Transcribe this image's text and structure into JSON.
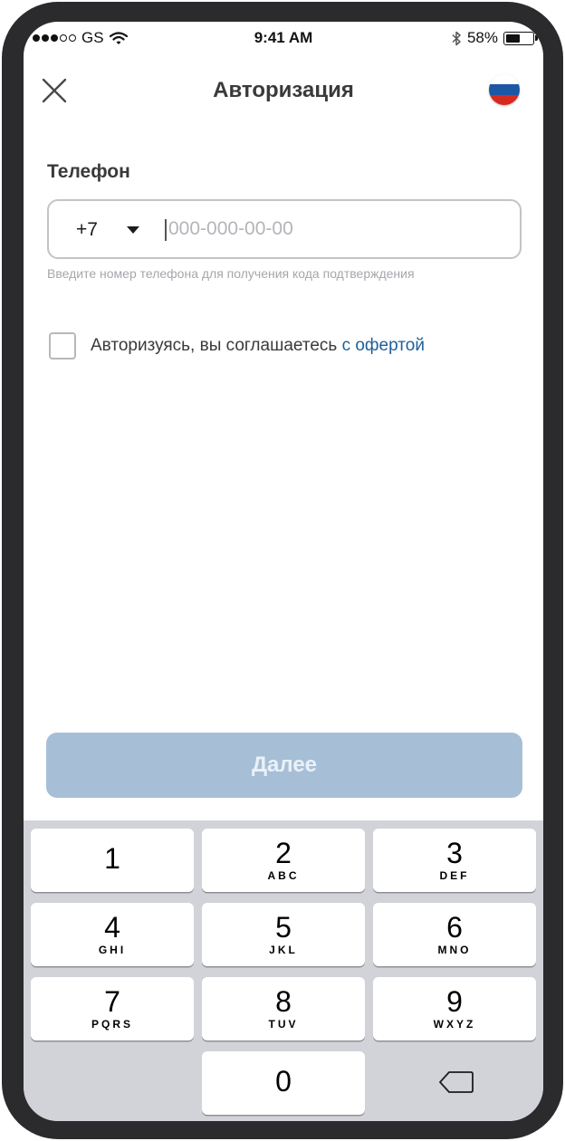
{
  "status_bar": {
    "carrier": "GS",
    "time": "9:41 AM",
    "battery_percent": "58%",
    "battery_level": 0.58
  },
  "header": {
    "title": "Авторизация",
    "close_icon": "close-icon",
    "flag_icon": "russia-flag-icon",
    "flag_colors": [
      "#ffffff",
      "#1c57a5",
      "#d52b1e"
    ]
  },
  "phone": {
    "label": "Телефон",
    "country_code": "+7",
    "value": "",
    "placeholder": "000-000-00-00",
    "hint": "Введите номер телефона для получения кода подтверждения"
  },
  "agreement": {
    "checked": false,
    "text": "Авторизуясь, вы соглашаетесь ",
    "link": "с офертой"
  },
  "next_button": {
    "label": "Далее",
    "color": "#a6bfd6"
  },
  "keypad": {
    "keys": [
      {
        "digit": "1",
        "letters": ""
      },
      {
        "digit": "2",
        "letters": "ABC"
      },
      {
        "digit": "3",
        "letters": "DEF"
      },
      {
        "digit": "4",
        "letters": "GHI"
      },
      {
        "digit": "5",
        "letters": "JKL"
      },
      {
        "digit": "6",
        "letters": "MNO"
      },
      {
        "digit": "7",
        "letters": "PQRS"
      },
      {
        "digit": "8",
        "letters": "TUV"
      },
      {
        "digit": "9",
        "letters": "WXYZ"
      },
      {
        "digit": "0",
        "letters": ""
      }
    ],
    "delete_icon": "backspace-icon"
  },
  "colors": {
    "accent_link": "#1f5f9a",
    "keypad_background": "#d1d3d9"
  }
}
